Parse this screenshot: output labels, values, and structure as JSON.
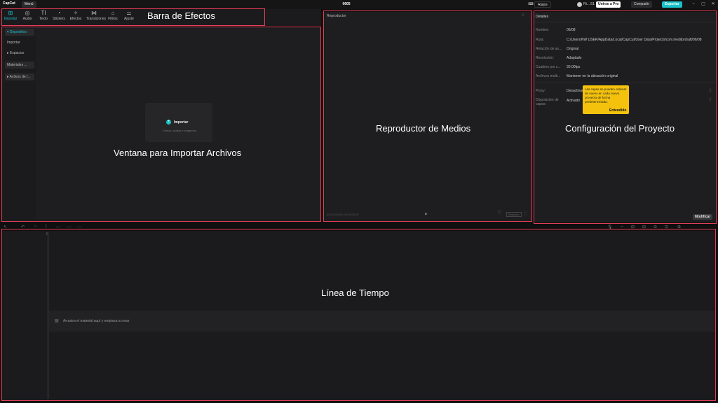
{
  "titlebar": {
    "logo": "CapCut",
    "menu": "Menú",
    "project_title": "0605",
    "shortcuts": "Atajos",
    "username": "Ri... 51",
    "pro": "Unirse a Pro",
    "share": "Compartir",
    "export": "Exportar",
    "win_min": "–",
    "win_max": "▢",
    "win_close": "✕"
  },
  "tools": [
    {
      "label": "Importar",
      "icon": "import-icon",
      "glyph": "⊞"
    },
    {
      "label": "Audio",
      "icon": "audio-icon",
      "glyph": "◎"
    },
    {
      "label": "Texto",
      "icon": "text-icon",
      "glyph": "TI"
    },
    {
      "label": "Stickers",
      "icon": "sticker-icon",
      "glyph": "◔"
    },
    {
      "label": "Efectos",
      "icon": "effects-icon",
      "glyph": "✧"
    },
    {
      "label": "Transiciones",
      "icon": "transitions-icon",
      "glyph": "⋈"
    },
    {
      "label": "Filtros",
      "icon": "filters-icon",
      "glyph": "⌂"
    },
    {
      "label": "Ajuste",
      "icon": "adjust-icon",
      "glyph": "⚌"
    }
  ],
  "sidebar": [
    {
      "label": "▾ Dispositivo"
    },
    {
      "label": "Importar"
    },
    {
      "label": "▸ Espacios"
    },
    {
      "label": "Materiales ..."
    },
    {
      "label": "▸ Activos de l..."
    }
  ],
  "import": {
    "button": "Importar",
    "hint": "Videos, audios e imágenes",
    "plus": "+"
  },
  "player": {
    "title": "Reproductor",
    "timecode": "00:00:00:00 | 00:00:00:00",
    "play": "▶",
    "ratio": "Relación",
    "fullscreen": "⛶"
  },
  "details": {
    "title": "Detalles",
    "rows": [
      {
        "key": "Nombre:",
        "value": "06/08"
      },
      {
        "key": "Ruta:",
        "value": "C:/Users/NW USER/AppData/Local/CapCut/User Data/Projects/com.lveditordraft/06/08"
      },
      {
        "key": "Relación de as...",
        "value": "Original"
      },
      {
        "key": "Resolución:",
        "value": "Adaptado"
      },
      {
        "key": "Cuadros por s...",
        "value": "30.00fps"
      },
      {
        "key": "Archivos multi...",
        "value": "Mantener en la ubicación original"
      }
    ],
    "proxy_key": "Proxy:",
    "proxy_value": "Desactivado",
    "layers_key": "Disposición de capas:",
    "layers_value": "Activado",
    "tooltip": "Las capas se pueden ordenar de nuevo en cada nuevo proyecto de forma predeterminada.",
    "tooltip_btn": "Entendido",
    "modify": "Modificar"
  },
  "timeline": {
    "zero": "0",
    "drop_text": "Arrastra el material aquí y empieza a crear"
  },
  "annotations": {
    "effects": "Barra de Efectos",
    "import": "Ventana para Importar Archivos",
    "player": "Reproductor de Medios",
    "config": "Configuración del Proyecto",
    "timeline": "Línea de Tiempo",
    "color": "#e23d58"
  }
}
